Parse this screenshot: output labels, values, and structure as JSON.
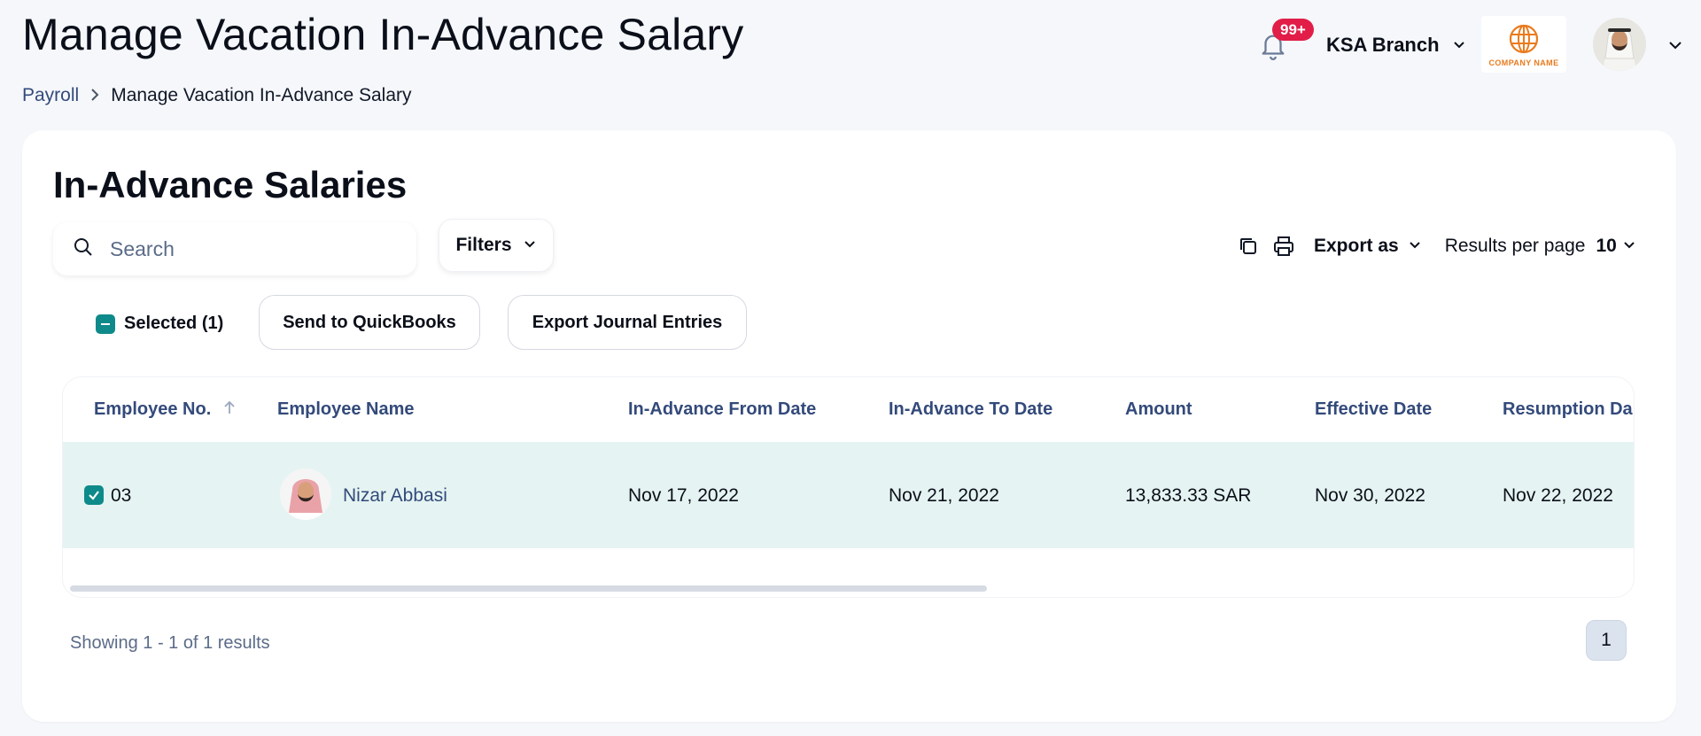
{
  "header": {
    "title": "Manage Vacation In-Advance Salary",
    "breadcrumb": {
      "parent": "Payroll",
      "current": "Manage Vacation In-Advance Salary"
    },
    "notifications": {
      "badge": "99+"
    },
    "branch": "KSA Branch",
    "company_logo_text": "COMPANY NAME"
  },
  "card": {
    "title": "In-Advance Salaries",
    "search": {
      "placeholder": "Search",
      "value": ""
    },
    "filters_label": "Filters",
    "export_label": "Export as",
    "results_per_page_label": "Results per page",
    "results_per_page_value": "10",
    "selected_label": "Selected (1)",
    "actions": {
      "send_quickbooks": "Send to QuickBooks",
      "export_journal": "Export Journal Entries"
    },
    "table": {
      "columns": {
        "employee_no": "Employee No.",
        "employee_name": "Employee Name",
        "from_date": "In-Advance From Date",
        "to_date": "In-Advance To Date",
        "amount": "Amount",
        "effective_date": "Effective Date",
        "resumption_date": "Resumption Da"
      },
      "rows": [
        {
          "employee_no": "03",
          "employee_name": "Nizar Abbasi",
          "from_date": "Nov 17, 2022",
          "to_date": "Nov 21, 2022",
          "amount": "13,833.33 SAR",
          "effective_date": "Nov 30, 2022",
          "resumption_date": "Nov 22, 2022",
          "selected": true
        }
      ]
    },
    "showing_text": "Showing 1 - 1 of 1 results",
    "pagination": {
      "current_page": "1"
    }
  },
  "colors": {
    "accent_teal": "#0f8a8a",
    "selected_row_bg": "#e5f4f2",
    "badge_red": "#e11d48",
    "link_navy": "#334a7a",
    "logo_orange": "#ea7a1d"
  },
  "icons": {
    "notifications": "bell-icon",
    "search": "search-icon",
    "copy": "copy-icon",
    "print": "printer-icon",
    "dropdown": "chevron-down-icon",
    "sort": "arrow-up-icon",
    "logo": "globe-icon"
  }
}
